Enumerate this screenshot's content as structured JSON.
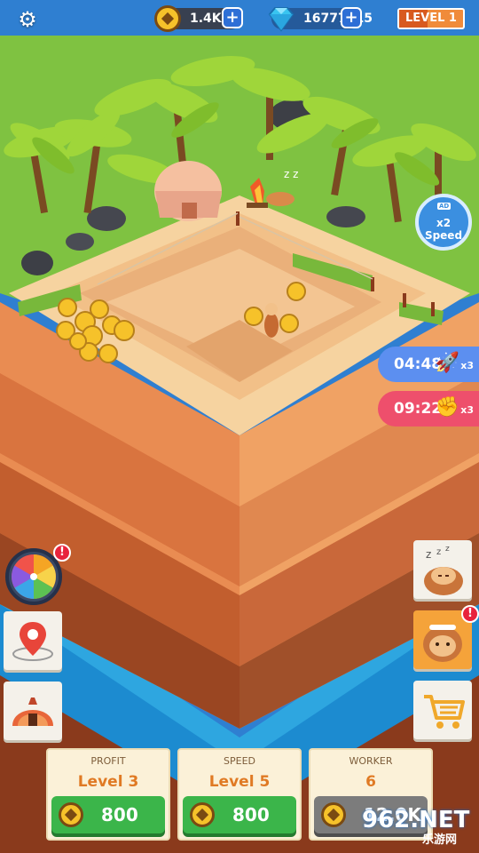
{
  "hud": {
    "coins": "1.4K",
    "gems": "16777215",
    "level": "LEVEL 1",
    "level_progress": 0.45
  },
  "speed_ad": {
    "tag": "AD",
    "multiplier": "x2",
    "label": "Speed"
  },
  "boosts": [
    {
      "time": "04:48",
      "icon": "rocket-icon",
      "mult": "x3"
    },
    {
      "time": "09:22",
      "icon": "fist-icon",
      "mult": "x3"
    }
  ],
  "alerts": {
    "wheel": "!",
    "worker": "!"
  },
  "upgrades": [
    {
      "title": "PROFIT",
      "level": "Level 3",
      "cost": "800",
      "enabled": true
    },
    {
      "title": "SPEED",
      "level": "Level 5",
      "cost": "800",
      "enabled": true
    },
    {
      "title": "WORKER",
      "level": "6",
      "cost": "12.0K",
      "enabled": false
    }
  ],
  "scene": {
    "sleep_text": "z z"
  },
  "watermark": {
    "site": "962.NET",
    "sub": "乐游网"
  },
  "colors": {
    "coin_gold": "#f6c22a",
    "button_green": "#3bb54a",
    "button_gray": "#7c7c7c",
    "rocket_timer": "#5c8ff0",
    "hand_timer": "#ee4f6c",
    "level_orange": "#f08b3a"
  }
}
